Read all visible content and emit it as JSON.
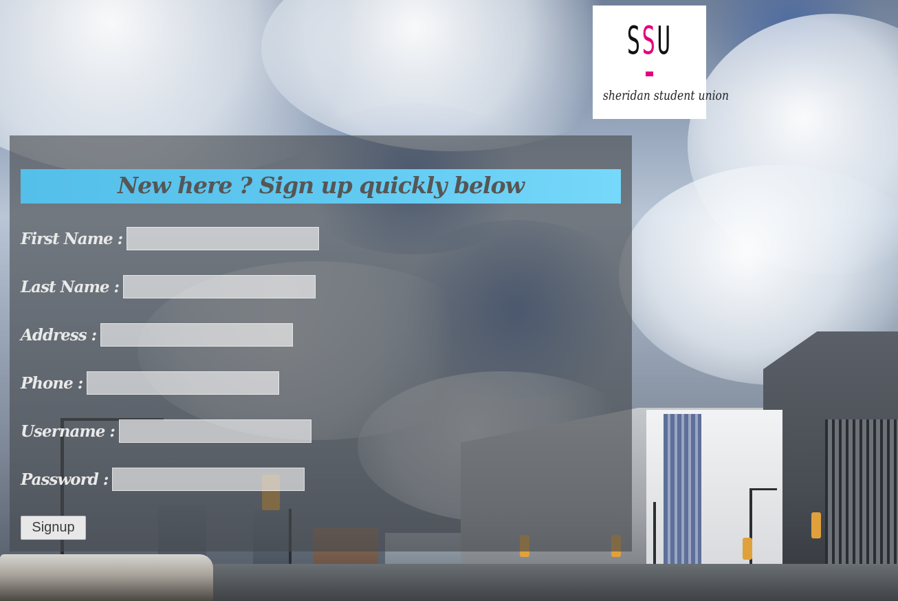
{
  "logo": {
    "mark_left": "S",
    "mark_mid": "S",
    "mark_right": "U",
    "tagline": "sheridan student union",
    "accent_color": "#e4007c"
  },
  "form": {
    "heading": "New here ? Sign up quickly below",
    "heading_bar_color": "#5fc8f0",
    "fields": [
      {
        "label": "First Name :",
        "value": ""
      },
      {
        "label": "Last Name :",
        "value": ""
      },
      {
        "label": "Address :",
        "value": ""
      },
      {
        "label": "Phone :",
        "value": ""
      },
      {
        "label": "Username :",
        "value": ""
      },
      {
        "label": "Password :",
        "value": ""
      }
    ],
    "submit_label": "Signup"
  }
}
